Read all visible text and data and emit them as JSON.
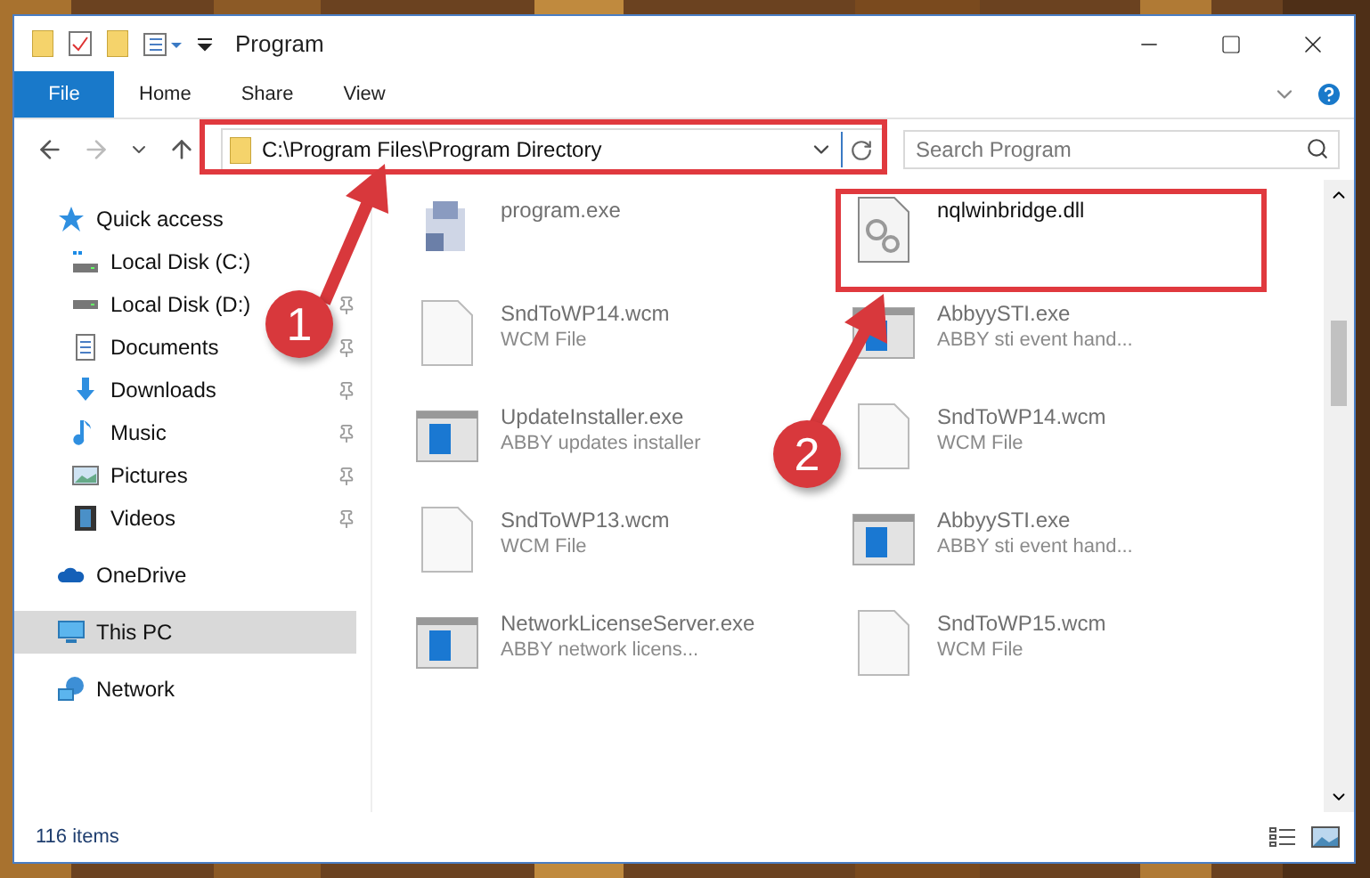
{
  "window": {
    "title": "Program"
  },
  "ribbon_tabs": [
    {
      "label": "File",
      "selected": true
    },
    {
      "label": "Home",
      "selected": false
    },
    {
      "label": "Share",
      "selected": false
    },
    {
      "label": "View",
      "selected": false
    }
  ],
  "address": {
    "value": "C:\\Program Files\\Program Directory"
  },
  "search": {
    "placeholder": "Search Program"
  },
  "sidebar": {
    "items": [
      {
        "label": "Quick access",
        "kind": "star",
        "selected": false,
        "children": [
          {
            "label": "Local Disk (C:)",
            "kind": "drive-c",
            "pinned": false
          },
          {
            "label": "Local Disk (D:)",
            "kind": "drive",
            "pinned": true
          },
          {
            "label": "Documents",
            "kind": "documents",
            "pinned": true
          },
          {
            "label": "Downloads",
            "kind": "downloads",
            "pinned": true
          },
          {
            "label": "Music",
            "kind": "music",
            "pinned": true
          },
          {
            "label": "Pictures",
            "kind": "pictures",
            "pinned": true
          },
          {
            "label": "Videos",
            "kind": "videos",
            "pinned": true
          }
        ]
      },
      {
        "label": "OneDrive",
        "kind": "cloud",
        "selected": false
      },
      {
        "label": "This PC",
        "kind": "pc",
        "selected": true
      },
      {
        "label": "Network",
        "kind": "network",
        "selected": false
      }
    ]
  },
  "files": [
    {
      "name": "program.exe",
      "kind": "app",
      "faded": true
    },
    {
      "name": "nqlwinbridge.dll",
      "kind": "dll",
      "faded": false
    },
    {
      "name": "SndToWP14.wcm",
      "type": "WCM File",
      "kind": "doc",
      "faded": true
    },
    {
      "name": "AbbyySTI.exe",
      "type": "ABBY sti event hand...",
      "kind": "window",
      "faded": true
    },
    {
      "name": "UpdateInstaller.exe",
      "type": "ABBY updates installer",
      "kind": "window",
      "faded": true
    },
    {
      "name": "SndToWP14.wcm",
      "type": "WCM File",
      "kind": "doc",
      "faded": true
    },
    {
      "name": "SndToWP13.wcm",
      "type": "WCM File",
      "kind": "doc",
      "faded": true
    },
    {
      "name": "AbbyySTI.exe",
      "type": "ABBY sti event hand...",
      "kind": "window",
      "faded": true
    },
    {
      "name": "NetworkLicenseServer.exe",
      "type": "ABBY network licens...",
      "kind": "window",
      "faded": true
    },
    {
      "name": "SndToWP15.wcm",
      "type": "WCM File",
      "kind": "doc",
      "faded": true
    }
  ],
  "status_bar": {
    "count": "116 items"
  },
  "annotations": [
    {
      "label": "1"
    },
    {
      "label": "2"
    }
  ]
}
